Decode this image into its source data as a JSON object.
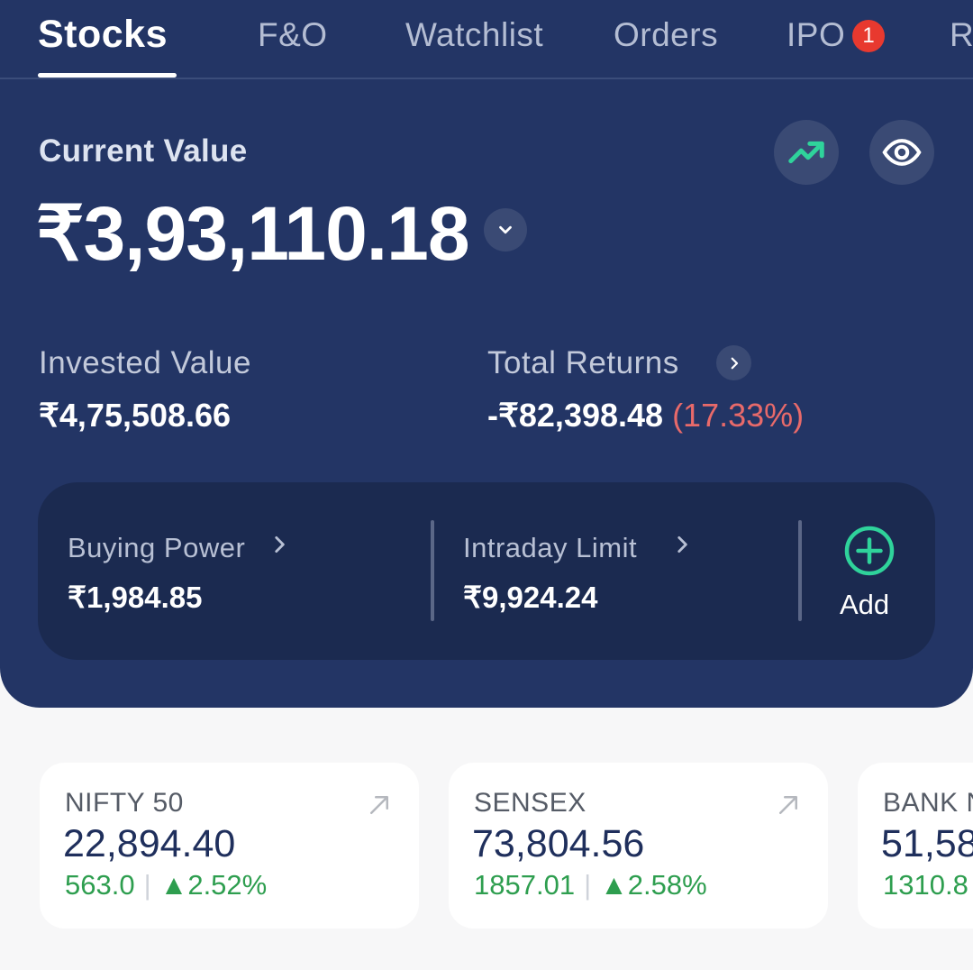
{
  "tabs": [
    {
      "label": "Stocks"
    },
    {
      "label": "F&O"
    },
    {
      "label": "Watchlist"
    },
    {
      "label": "Orders"
    },
    {
      "label": "IPO",
      "badge": "1"
    },
    {
      "label": "R"
    }
  ],
  "summary": {
    "current_value_label": "Current Value",
    "current_value": "₹3,93,110.18",
    "invested_label": "Invested Value",
    "invested_value": "₹4,75,508.66",
    "returns_label": "Total Returns",
    "returns_value": "-₹82,398.48",
    "returns_pct": "(17.33%)"
  },
  "power": {
    "buying_label": "Buying Power",
    "buying_value": "₹1,984.85",
    "intraday_label": "Intraday Limit",
    "intraday_value": "₹9,924.24",
    "add_label": "Add"
  },
  "indices": [
    {
      "name": "NIFTY 50",
      "value": "22,894.40",
      "change": "563.0",
      "pct": "▲2.52%"
    },
    {
      "name": "SENSEX",
      "value": "73,804.56",
      "change": "1857.01",
      "pct": "▲2.58%"
    },
    {
      "name": "BANK NIFTY",
      "value": "51,58",
      "change": "1310.8"
    }
  ],
  "colors": {
    "header_bg": "#233565",
    "panel_bg": "#1b2a50",
    "positive": "#2e9e4f",
    "negative": "#e86a6a",
    "accent": "#2fd39b",
    "badge": "#e8392f"
  },
  "icons": [
    "trending-up-icon",
    "eye-icon",
    "chevron-down-icon",
    "chevron-right-icon",
    "plus-circle-icon",
    "arrow-up-right-icon"
  ]
}
